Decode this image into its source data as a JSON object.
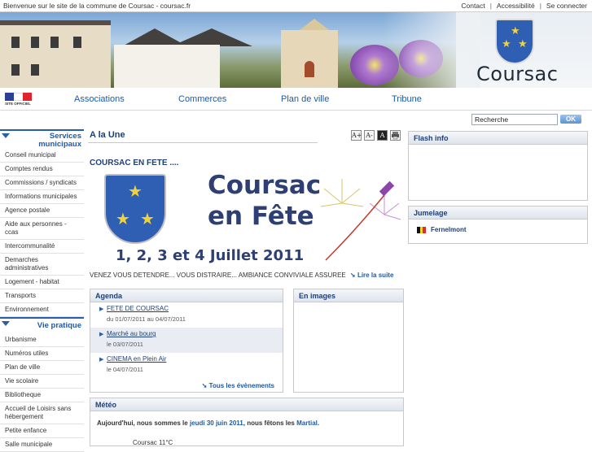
{
  "top": {
    "welcome": "Bienvenue sur le site de la commune de Coursac - coursac.fr",
    "links": [
      "Contact",
      "Accessibilité",
      "Se connecter"
    ],
    "separators": [
      "|",
      "|"
    ]
  },
  "banner": {
    "brand": "Coursac"
  },
  "nav": {
    "logo_caption": "SITE OFFICIEL",
    "items": [
      "Associations",
      "Commerces",
      "Plan de ville",
      "Tribune"
    ]
  },
  "search": {
    "value": "Recherche",
    "button": "OK"
  },
  "sidebar": {
    "services_title": "Services municipaux",
    "services": [
      "Conseil municipal",
      "Comptes rendus",
      "Commissions / syndicats",
      "Informations municipales",
      "Agence postale",
      "Aide aux personnes - ccas",
      "Intercommunalité",
      "Demarches administratives",
      "Logement - habitat",
      "Transports",
      "Environnement"
    ],
    "vie_title": "Vie pratique",
    "vie": [
      "Urbanisme",
      "Numéros utiles",
      "Plan de ville",
      "Vie scolaire",
      "Bibliotheque",
      "Accueil de Loisirs sans hébergement",
      "Petite enfance",
      "Salle municipale"
    ]
  },
  "main": {
    "section_title": "A la Une",
    "tools": [
      "A+",
      "A-",
      "A",
      "print"
    ],
    "feature_title": "COURSAC EN FETE ....",
    "feature_image": {
      "line1": "Coursac",
      "line2": "en Fête",
      "dates": "1, 2, 3 et 4 Juillet 2011"
    },
    "caption": "VENEZ VOUS DETENDRE... VOUS DISTRAIRE... AMBIANCE CONVIVIALE ASSUREE",
    "readmore": "Lire la suite",
    "agenda": {
      "title": "Agenda",
      "items": [
        {
          "label": "FETE DE COURSAC",
          "date": "du 01/07/2011 au 04/07/2011"
        },
        {
          "label": "Marché au bourg",
          "date": "le 03/07/2011"
        },
        {
          "label": "CINEMA en Plein Air",
          "date": "le 04/07/2011"
        }
      ],
      "all": "Tous les évènements"
    },
    "images_title": "En images",
    "meteo": {
      "title": "Météo",
      "prefix": "Aujourd'hui, nous sommes le",
      "date": "jeudi 30 juin 2011",
      "middle": ", nous fêtons les",
      "saint": "Martial",
      "end": ".",
      "temp": "Coursac 11°C"
    }
  },
  "right": {
    "flash_title": "Flash info",
    "jumelage_title": "Jumelage",
    "jumelage_item": "Fernelmont"
  },
  "colors": {
    "accent": "#1e5aa8",
    "heading": "#1e3f77",
    "crest": "#2f5fb3"
  }
}
